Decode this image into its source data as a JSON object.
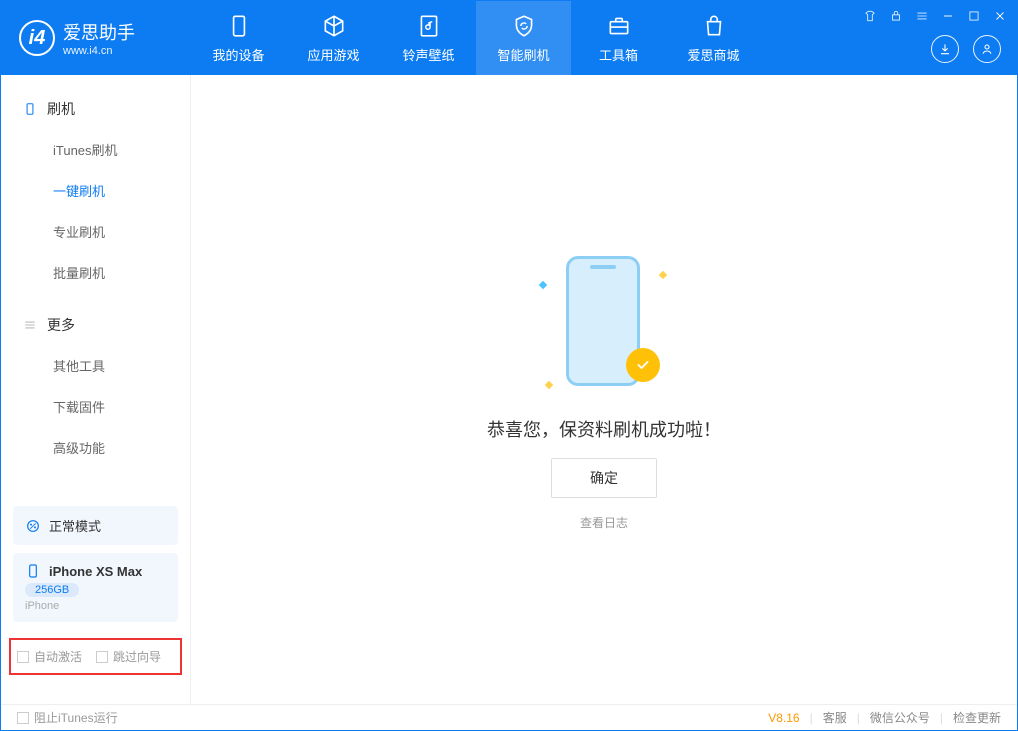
{
  "header": {
    "logo_title": "爱思助手",
    "logo_sub": "www.i4.cn",
    "tabs": [
      {
        "label": "我的设备"
      },
      {
        "label": "应用游戏"
      },
      {
        "label": "铃声壁纸"
      },
      {
        "label": "智能刷机"
      },
      {
        "label": "工具箱"
      },
      {
        "label": "爱思商城"
      }
    ]
  },
  "sidebar": {
    "section1": "刷机",
    "items1": [
      {
        "label": "iTunes刷机"
      },
      {
        "label": "一键刷机"
      },
      {
        "label": "专业刷机"
      },
      {
        "label": "批量刷机"
      }
    ],
    "section2": "更多",
    "items2": [
      {
        "label": "其他工具"
      },
      {
        "label": "下载固件"
      },
      {
        "label": "高级功能"
      }
    ],
    "mode": "正常模式",
    "device_name": "iPhone XS Max",
    "capacity": "256GB",
    "device_type": "iPhone",
    "check1": "自动激活",
    "check2": "跳过向导"
  },
  "main": {
    "success_text": "恭喜您，保资料刷机成功啦！",
    "ok_label": "确定",
    "log_link": "查看日志"
  },
  "footer": {
    "block_itunes": "阻止iTunes运行",
    "version": "V8.16",
    "link1": "客服",
    "link2": "微信公众号",
    "link3": "检查更新"
  }
}
